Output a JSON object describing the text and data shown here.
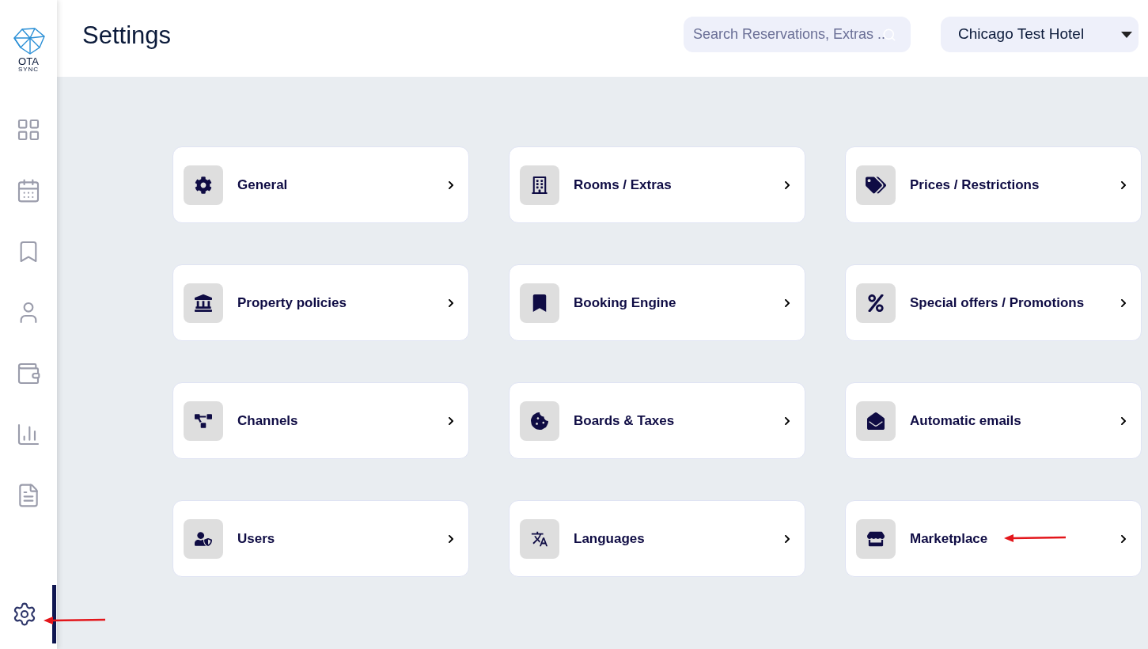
{
  "sidebar": {
    "logo": {
      "name": "OTA",
      "sub": "SYNC"
    },
    "items": [
      {
        "selected": false
      },
      {
        "selected": false
      },
      {
        "selected": false
      },
      {
        "selected": false
      },
      {
        "selected": false
      },
      {
        "selected": false
      },
      {
        "selected": false
      }
    ],
    "footer_item": {
      "selected": true
    }
  },
  "header": {
    "title": "Settings",
    "search": {
      "placeholder": "Search Reservations, Extras .."
    },
    "property_select": {
      "value": "Chicago Test Hotel"
    }
  },
  "cards": [
    {
      "label": "General"
    },
    {
      "label": "Rooms / Extras"
    },
    {
      "label": "Prices / Restrictions"
    },
    {
      "label": "Property policies"
    },
    {
      "label": "Booking Engine"
    },
    {
      "label": "Special offers / Promotions"
    },
    {
      "label": "Channels"
    },
    {
      "label": "Boards & Taxes"
    },
    {
      "label": "Automatic emails"
    },
    {
      "label": "Users"
    },
    {
      "label": "Languages"
    },
    {
      "label": "Marketplace"
    }
  ]
}
